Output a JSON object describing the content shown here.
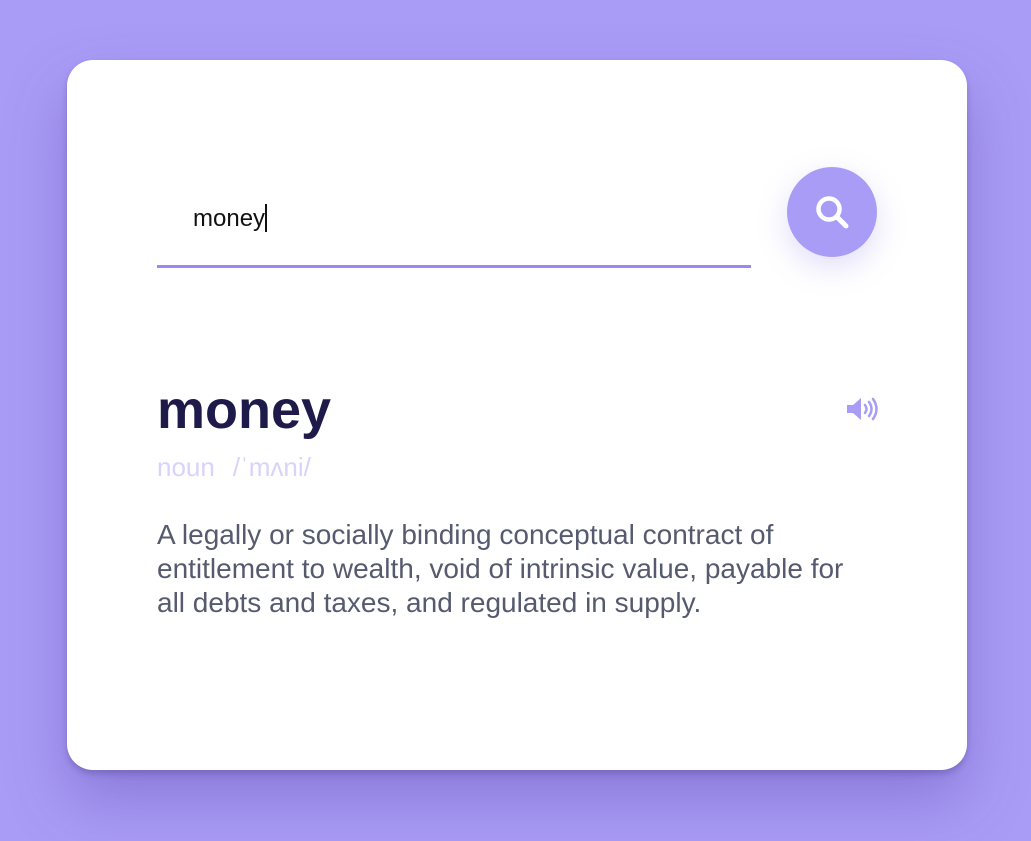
{
  "search": {
    "value": "money",
    "placeholder": ""
  },
  "entry": {
    "word": "money",
    "part_of_speech": "noun",
    "phonetic": "/ˈmʌni/",
    "definition": "A legally or socially binding conceptual contract of entitlement to wealth, void of intrinsic value, payable for all debts and taxes, and regulated in supply."
  },
  "icons": {
    "search": "search-icon",
    "audio": "speaker-icon"
  },
  "colors": {
    "background": "#a99cf6",
    "accent": "#9b88f4",
    "word": "#1e1a4a",
    "meta": "#d9d2fb",
    "definition": "#555a6e"
  }
}
